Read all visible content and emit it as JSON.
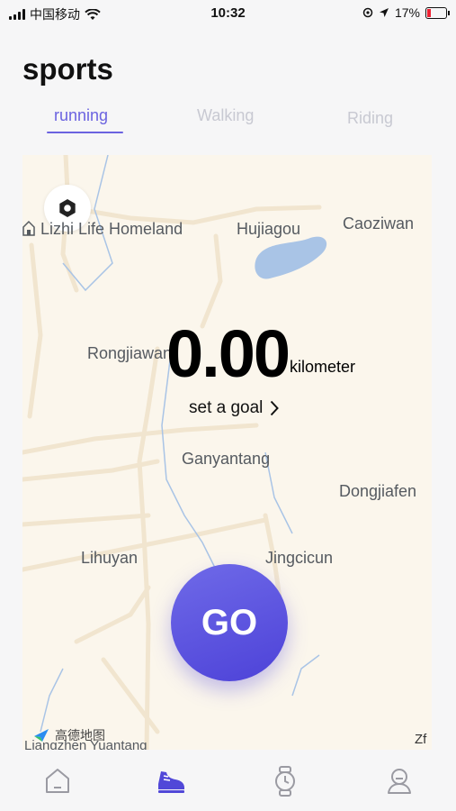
{
  "status": {
    "carrier": "中国移动",
    "time": "10:32",
    "battery": "17%"
  },
  "page": {
    "title": "sports"
  },
  "tabs": [
    {
      "label": "running",
      "active": true
    },
    {
      "label": "Walking",
      "active": false
    },
    {
      "label": "Riding",
      "active": false
    }
  ],
  "map": {
    "places": [
      "Lizhi Life Homeland",
      "Hujiagou",
      "Caoziwan",
      "Rongjiawan",
      "Ganyantang",
      "Dongjiafen",
      "Lihuyan",
      "Jingcicun",
      "Liangzhen Yuantang"
    ],
    "provider": "高德地图",
    "corner_text": "Zf"
  },
  "workout": {
    "distance": "0.00",
    "unit": "kilometer",
    "goal_label": "set a goal"
  },
  "go_button": {
    "label": "GO"
  },
  "tabbar": [
    {
      "icon": "home-icon",
      "active": false
    },
    {
      "icon": "shoe-icon",
      "active": true
    },
    {
      "icon": "watch-icon",
      "active": false
    },
    {
      "icon": "profile-icon",
      "active": false
    }
  ],
  "colors": {
    "accent": "#6b63e0",
    "inactive_tab": "#c8c9d2",
    "map_bg": "#fbf6ec"
  }
}
